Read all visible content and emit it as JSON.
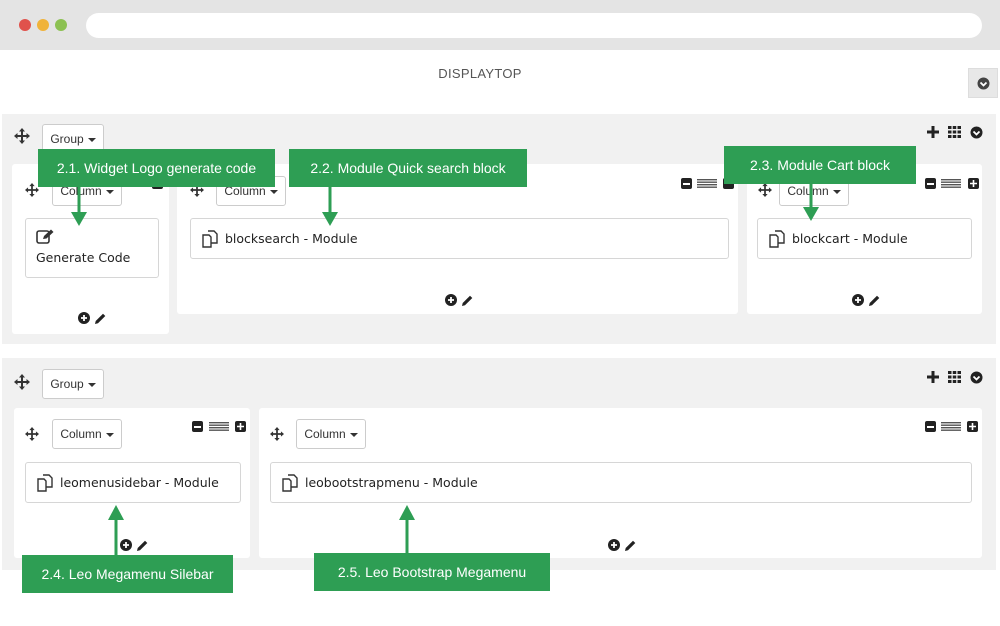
{
  "page": {
    "title": "DISPLAYTOP"
  },
  "group_label": "Group",
  "column_label": "Column",
  "widgets": {
    "generate_code": "Generate Code",
    "blocksearch": "blocksearch - Module",
    "blockcart": "blockcart - Module",
    "leomenusidebar": "leomenusidebar - Module",
    "leobootstrapmenu": "leobootstrapmenu - Module"
  },
  "callouts": {
    "c21": "2.1. Widget Logo generate code",
    "c22": "2.2. Module Quick search block",
    "c23": "2.3. Module Cart block",
    "c24": "2.4. Leo Megamenu Silebar",
    "c25": "2.5. Leo Bootstrap Megamenu"
  },
  "colors": {
    "callout": "#2e9e54",
    "window_close": "#e0524c",
    "window_min": "#f0b33a",
    "window_max": "#8cc152"
  },
  "icons": [
    "move-icon",
    "caret-down-icon",
    "plus-icon",
    "grid-icon",
    "collapse-icon",
    "minus-square-icon",
    "lines-icon",
    "plus-square-icon",
    "edit-icon",
    "copy-icon",
    "add-circle-icon",
    "pencil-icon"
  ]
}
